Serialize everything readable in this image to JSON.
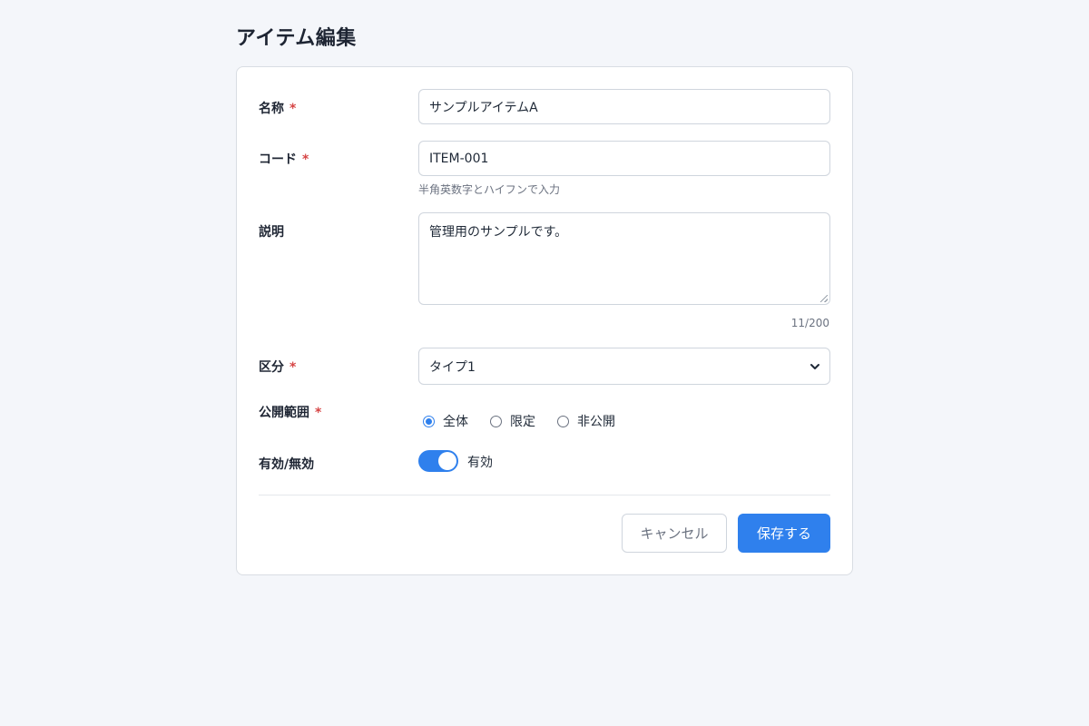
{
  "page": {
    "title": "アイテム編集"
  },
  "form": {
    "name": {
      "label": "名称",
      "required_mark": "*",
      "value": "サンプルアイテムA"
    },
    "code": {
      "label": "コード",
      "required_mark": "*",
      "value": "ITEM-001",
      "hint": "半角英数字とハイフンで入力"
    },
    "description": {
      "label": "説明",
      "value": "管理用のサンプルです。",
      "counter": "11/200"
    },
    "category": {
      "label": "区分",
      "required_mark": "*",
      "selected": "タイプ1"
    },
    "visibility": {
      "label": "公開範囲",
      "required_mark": "*",
      "options": [
        {
          "label": "全体",
          "checked": true
        },
        {
          "label": "限定",
          "checked": false
        },
        {
          "label": "非公開",
          "checked": false
        }
      ]
    },
    "enabled": {
      "label": "有効/無効",
      "state_label": "有効",
      "on": true
    }
  },
  "actions": {
    "cancel_label": "キャンセル",
    "save_label": "保存する"
  },
  "colors": {
    "accent": "#2f80ed",
    "required": "#d64545",
    "page_bg": "#f4f6fa"
  }
}
